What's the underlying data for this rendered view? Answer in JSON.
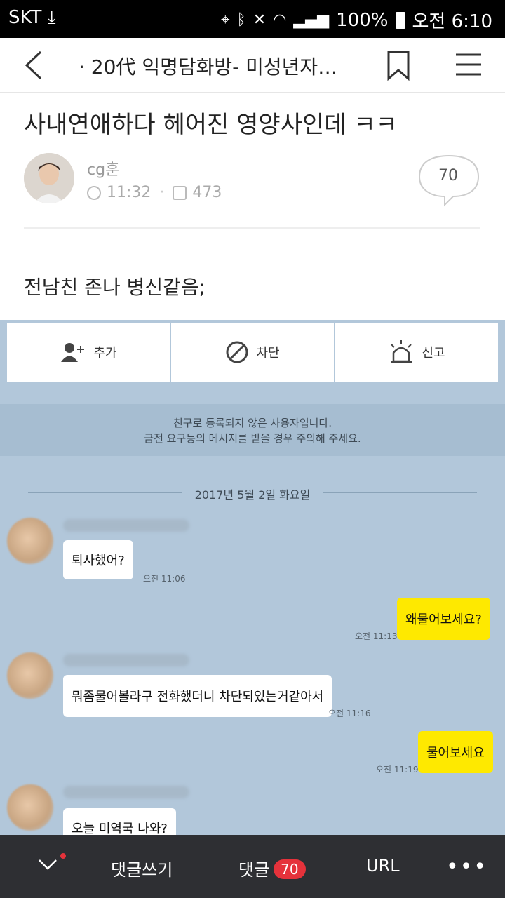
{
  "status_bar": {
    "carrier": "SKT",
    "download_icon": "download-icon",
    "battery": "100%",
    "time": "오전 6:10",
    "icons": [
      "location-icon",
      "bluetooth-icon",
      "mute-icon",
      "wifi-icon",
      "signal-icon",
      "battery-icon"
    ]
  },
  "nav": {
    "title": "· 20代 익명담화방- 미성년자…",
    "back_icon": "back-arrow-icon",
    "bookmark_icon": "bookmark-icon",
    "menu_icon": "hamburger-menu-icon"
  },
  "post": {
    "title": "사내연애하다 헤어진 영양사인데 ㅋㅋ",
    "author": "cg훈",
    "time": "11:32",
    "views": "473",
    "comment_count": "70",
    "body": "전남친 존나 병신같음;"
  },
  "chat": {
    "buttons": [
      {
        "label": "추가",
        "icon": "add-friend-icon"
      },
      {
        "label": "차단",
        "icon": "block-icon"
      },
      {
        "label": "신고",
        "icon": "report-siren-icon"
      }
    ],
    "notice_line1": "친구로 등록되지 않은 사용자입니다.",
    "notice_line2": "금전 요구등의 메시지를 받을 경우 주의해 주세요.",
    "date": "2017년 5월 2일 화요일",
    "messages": [
      {
        "from": "other",
        "text": "퇴사했어?",
        "time": "오전 11:06"
      },
      {
        "from": "me",
        "text": "왜물어보세요?",
        "time": "오전 11:13"
      },
      {
        "from": "other",
        "text": "뭐좀물어볼라구 전화했더니 차단되있는거같아서",
        "time": "오전 11:16"
      },
      {
        "from": "me",
        "text": "물어보세요",
        "time": "오전 11:19"
      },
      {
        "from": "other",
        "text": "오늘 미역국 나와?",
        "time": ""
      }
    ]
  },
  "bottom_bar": {
    "write_comment": "댓글쓰기",
    "comments": "댓글",
    "comments_badge": "70",
    "url": "URL",
    "more": "•••",
    "accent": "#e5323b"
  }
}
